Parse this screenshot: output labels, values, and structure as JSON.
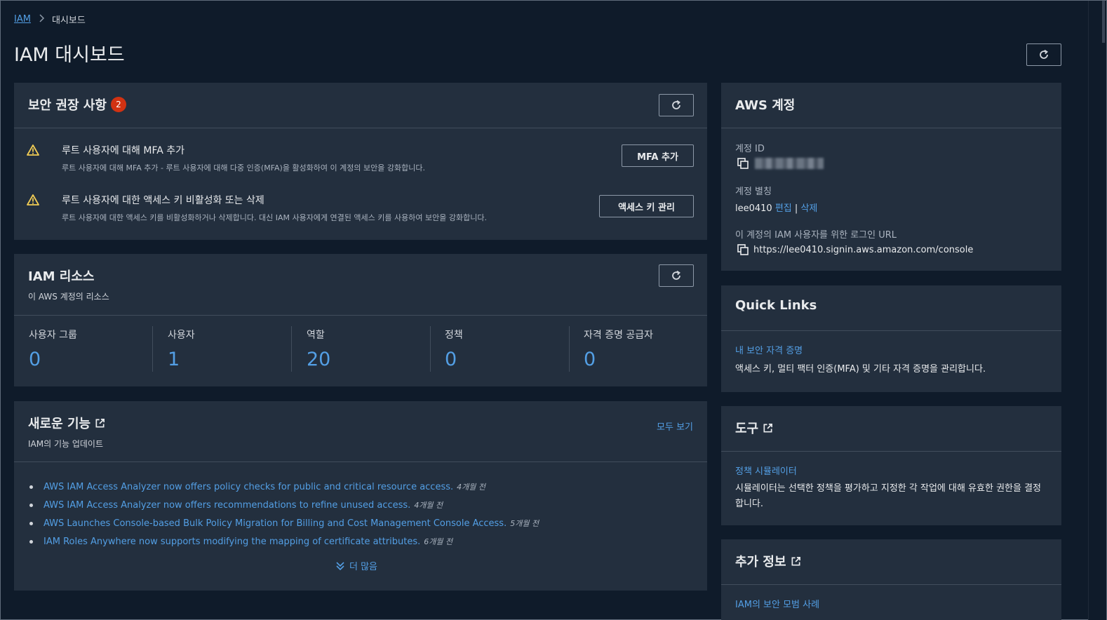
{
  "breadcrumb": {
    "root": "IAM",
    "current": "대시보드"
  },
  "page": {
    "title": "IAM 대시보드"
  },
  "security": {
    "title": "보안 권장 사항",
    "badge": "2",
    "items": [
      {
        "title": "루트 사용자에 대해 MFA 추가",
        "description": "루트 사용자에 대해 MFA 추가 - 루트 사용자에 대해 다중 인증(MFA)을 활성화하여 이 계정의 보안을 강화합니다.",
        "button": "MFA 추가"
      },
      {
        "title": "루트 사용자에 대한 액세스 키 비활성화 또는 삭제",
        "description": "루트 사용자에 대한 액세스 키를 비활성화하거나 삭제합니다. 대신 IAM 사용자에게 연결된 액세스 키를 사용하여 보안을 강화합니다.",
        "button": "액세스 키 관리"
      }
    ]
  },
  "resources": {
    "title": "IAM 리소스",
    "subtitle": "이 AWS 계정의 리소스",
    "stats": [
      {
        "label": "사용자 그룹",
        "value": "0"
      },
      {
        "label": "사용자",
        "value": "1"
      },
      {
        "label": "역할",
        "value": "20"
      },
      {
        "label": "정책",
        "value": "0"
      },
      {
        "label": "자격 증명 공급자",
        "value": "0"
      }
    ]
  },
  "whats_new": {
    "title": "새로운 기능",
    "subtitle": "IAM의 기능 업데이트",
    "view_all": "모두 보기",
    "more": "더 많음",
    "items": [
      {
        "text": "AWS IAM Access Analyzer now offers policy checks for public and critical resource access.",
        "ago": "4개월 전"
      },
      {
        "text": "AWS IAM Access Analyzer now offers recommendations to refine unused access.",
        "ago": "4개월 전"
      },
      {
        "text": "AWS Launches Console-based Bulk Policy Migration for Billing and Cost Management Console Access.",
        "ago": "5개월 전"
      },
      {
        "text": "IAM Roles Anywhere now supports modifying the mapping of certificate attributes.",
        "ago": "6개월 전"
      }
    ]
  },
  "account": {
    "title": "AWS 계정",
    "id_label": "계정 ID",
    "alias_label": "계정 별칭",
    "alias": "lee0410",
    "edit": "편집",
    "divider": "|",
    "delete": "삭제",
    "signin_label": "이 계정의 IAM 사용자를 위한 로그인 URL",
    "signin_url": "https://lee0410.signin.aws.amazon.com/console"
  },
  "quick_links": {
    "title": "Quick Links",
    "link": "내 보안 자격 증명",
    "description": "액세스 키, 멀티 팩터 인증(MFA) 및 기타 자격 증명을 관리합니다."
  },
  "tools": {
    "title": "도구",
    "link": "정책 시뮬레이터",
    "description": "시뮬레이터는 선택한 정책을 평가하고 지정한 각 작업에 대해 유효한 권한을 결정합니다."
  },
  "more_info": {
    "title": "추가 정보",
    "link": "IAM의 보안 모범 사례"
  },
  "colors": {
    "link": "#539fe5",
    "panel": "#232f3e",
    "background": "#0f1b2a",
    "badge": "#d13212",
    "warning": "#f2cd54"
  }
}
